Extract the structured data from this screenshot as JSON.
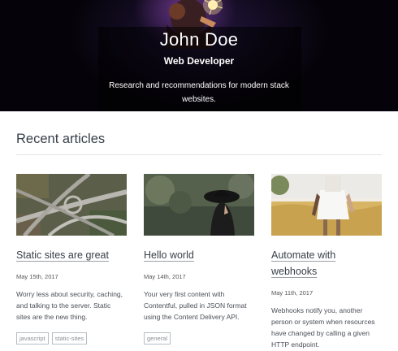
{
  "hero": {
    "name": "John Doe",
    "title": "Web Developer",
    "tagline": "Research and recommendations for modern stack websites."
  },
  "section": {
    "title": "Recent articles"
  },
  "articles": [
    {
      "title": "Static sites are great",
      "date": "May 15th, 2017",
      "description": "Worry less about security, caching, and talking to the server. Static sites are the new thing.",
      "tags": [
        "javascript",
        "static-sites"
      ]
    },
    {
      "title": "Hello world",
      "date": "May 14th, 2017",
      "description": "Your very first content with Contentful, pulled in JSON format using the Content Delivery API.",
      "tags": [
        "general"
      ]
    },
    {
      "title": "Automate with webhooks",
      "date": "May 11th, 2017",
      "description": "Webhooks notify you, another person or system when resources have changed by calling a given HTTP endpoint.",
      "tags": []
    }
  ]
}
